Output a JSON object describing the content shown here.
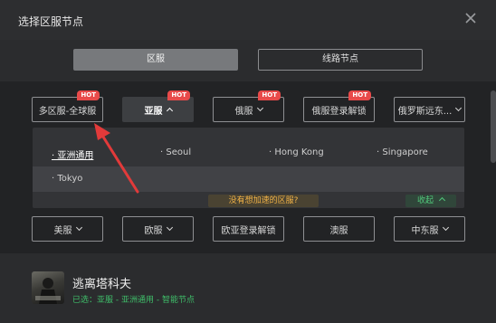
{
  "window": {
    "title": "选择区服节点",
    "close_icon": "close-icon"
  },
  "tabs": [
    {
      "label": "区服",
      "active": true
    },
    {
      "label": "线路节点",
      "active": false
    }
  ],
  "regions_row1": [
    {
      "label": "多区服-全球服",
      "badge": "HOT",
      "selected": false
    },
    {
      "label": "亚服",
      "badge": "HOT",
      "selected": true
    },
    {
      "label": "俄服",
      "badge": "HOT",
      "selected": false
    },
    {
      "label": "俄服登录解锁",
      "badge": "HOT",
      "selected": false
    },
    {
      "label": "俄罗斯远东...",
      "badge": "",
      "selected": false
    }
  ],
  "nodes": [
    {
      "label": "· 亚洲通用",
      "active": true
    },
    {
      "label": "· Seoul",
      "active": false
    },
    {
      "label": "· Hong Kong",
      "active": false
    },
    {
      "label": "· Singapore",
      "active": false
    },
    {
      "label": "· Tokyo",
      "active": false
    }
  ],
  "dropdown_footer": {
    "notice": "没有想加速的区服?",
    "collapse": "收起",
    "notice_color": "#f2b347",
    "collapse_color": "#52c97c"
  },
  "regions_row2": [
    {
      "label": "美服"
    },
    {
      "label": "欧服"
    },
    {
      "label": "欧亚登录解锁"
    },
    {
      "label": "澳服"
    },
    {
      "label": "中东服"
    }
  ],
  "game": {
    "name": "逃离塔科夫",
    "status": "已选：亚服 - 亚洲通用 - 智能节点",
    "status_color": "#3fbf6a"
  },
  "colors": {
    "accent_hot": "#e84a4a",
    "background": "#2b2c2e",
    "panel": "#222325"
  }
}
